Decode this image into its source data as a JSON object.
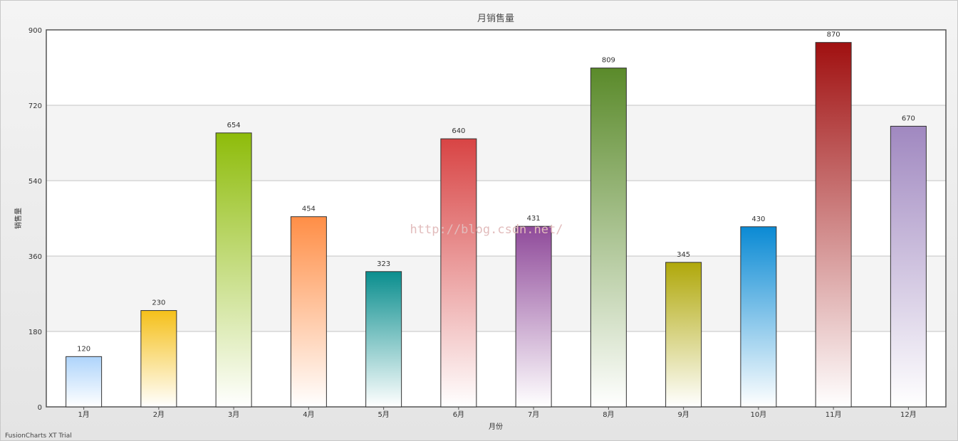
{
  "chart_data": {
    "type": "bar",
    "title": "月销售量",
    "xlabel": "月份",
    "ylabel": "销售量",
    "categories": [
      "1月",
      "2月",
      "3月",
      "4月",
      "5月",
      "6月",
      "7月",
      "8月",
      "9月",
      "10月",
      "11月",
      "12月"
    ],
    "values": [
      120,
      230,
      654,
      454,
      323,
      640,
      431,
      809,
      345,
      430,
      870,
      670
    ],
    "ylim": [
      0,
      900
    ],
    "yticks": [
      0,
      180,
      360,
      540,
      720,
      900
    ],
    "grid": true,
    "legend": "none",
    "colors": [
      "#aed4fb",
      "#f5c01a",
      "#8ebc0a",
      "#ff8e46",
      "#0a8e8e",
      "#d84444",
      "#8f4a9a",
      "#5a8a2a",
      "#b0a80a",
      "#0a8ad4",
      "#a01010",
      "#a088c0"
    ]
  },
  "watermark": "http://blog.csdn.net/",
  "footer": "FusionCharts XT Trial"
}
